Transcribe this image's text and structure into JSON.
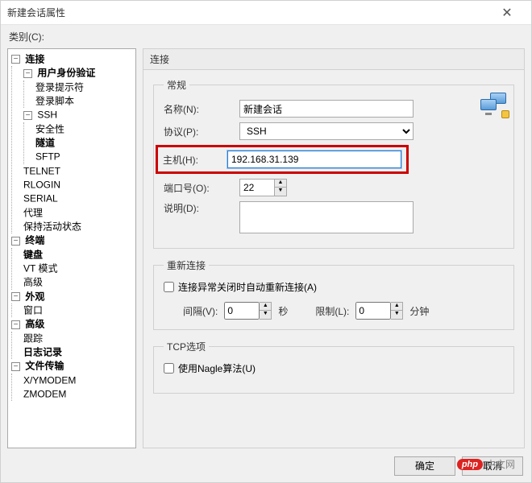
{
  "window": {
    "title": "新建会话属性"
  },
  "category_label": "类别(C):",
  "tree": {
    "connection": "连接",
    "auth": "用户身份验证",
    "login_prompt": "登录提示符",
    "login_script": "登录脚本",
    "ssh": "SSH",
    "security": "安全性",
    "tunnel": "隧道",
    "sftp": "SFTP",
    "telnet": "TELNET",
    "rlogin": "RLOGIN",
    "serial": "SERIAL",
    "proxy": "代理",
    "keepalive": "保持活动状态",
    "terminal": "终端",
    "keyboard": "键盘",
    "vtmode": "VT 模式",
    "advanced_term": "高级",
    "appearance": "外观",
    "window": "窗口",
    "advanced": "高级",
    "trace": "跟踪",
    "log": "日志记录",
    "filetransfer": "文件传输",
    "xymodem": "X/YMODEM",
    "zmodem": "ZMODEM"
  },
  "panel": {
    "title": "连接",
    "groups": {
      "general": "常规",
      "reconnect": "重新连接",
      "tcp": "TCP选项"
    },
    "labels": {
      "name": "名称(N):",
      "protocol": "协议(P):",
      "host": "主机(H):",
      "port": "端口号(O):",
      "description": "说明(D):",
      "reconnect_checkbox": "连接异常关闭时自动重新连接(A)",
      "interval": "间隔(V):",
      "seconds": "秒",
      "limit": "限制(L):",
      "minutes": "分钟",
      "nagle": "使用Nagle算法(U)"
    },
    "values": {
      "name": "新建会话",
      "protocol": "SSH",
      "host": "192.168.31.139",
      "port": "22",
      "description": "",
      "interval": "0",
      "limit": "0"
    }
  },
  "buttons": {
    "ok": "确定",
    "cancel": "取消"
  },
  "watermark": {
    "p": "php",
    "text": "中文网"
  }
}
